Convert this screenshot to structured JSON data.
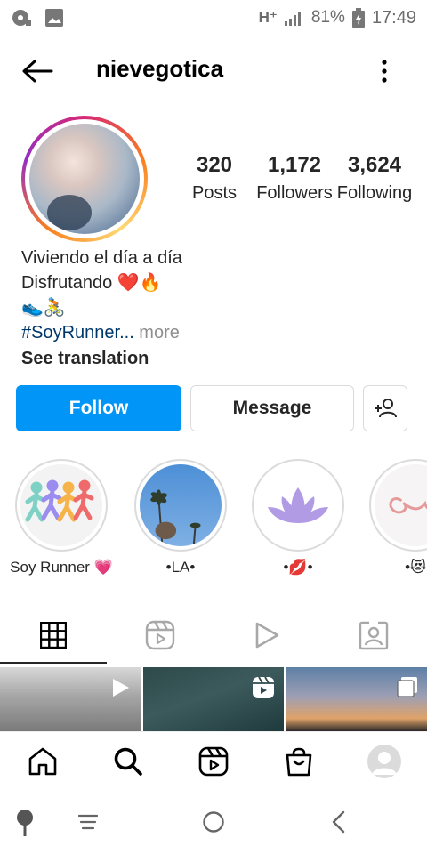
{
  "status_bar": {
    "network": "H⁺",
    "battery": "81%",
    "time": "17:49"
  },
  "header": {
    "username": "nievegotica"
  },
  "profile": {
    "stats": [
      {
        "value": "320",
        "label": "Posts"
      },
      {
        "value": "1,172",
        "label": "Followers"
      },
      {
        "value": "3,624",
        "label": "Following"
      }
    ],
    "bio": {
      "line1": "Viviendo el día a día",
      "line2": "Disfrutando ❤️🔥",
      "line3": "👟🚴",
      "hashtag": "#SoyRunner...",
      "more": " more",
      "translate": "See translation"
    }
  },
  "actions": {
    "follow": "Follow",
    "message": "Message"
  },
  "highlights": [
    {
      "label": "Soy Runner 💗"
    },
    {
      "label": "•LA•"
    },
    {
      "label": "•💋•"
    },
    {
      "label": "•😻"
    }
  ],
  "tabs": {
    "active": "grid",
    "items": [
      "grid-icon",
      "reels-icon",
      "video-icon",
      "tagged-icon"
    ]
  },
  "colors": {
    "accent": "#0095f6",
    "text": "#262626",
    "hashtag": "#00376b",
    "muted": "#8e8e8e",
    "border": "#dbdbdb"
  }
}
